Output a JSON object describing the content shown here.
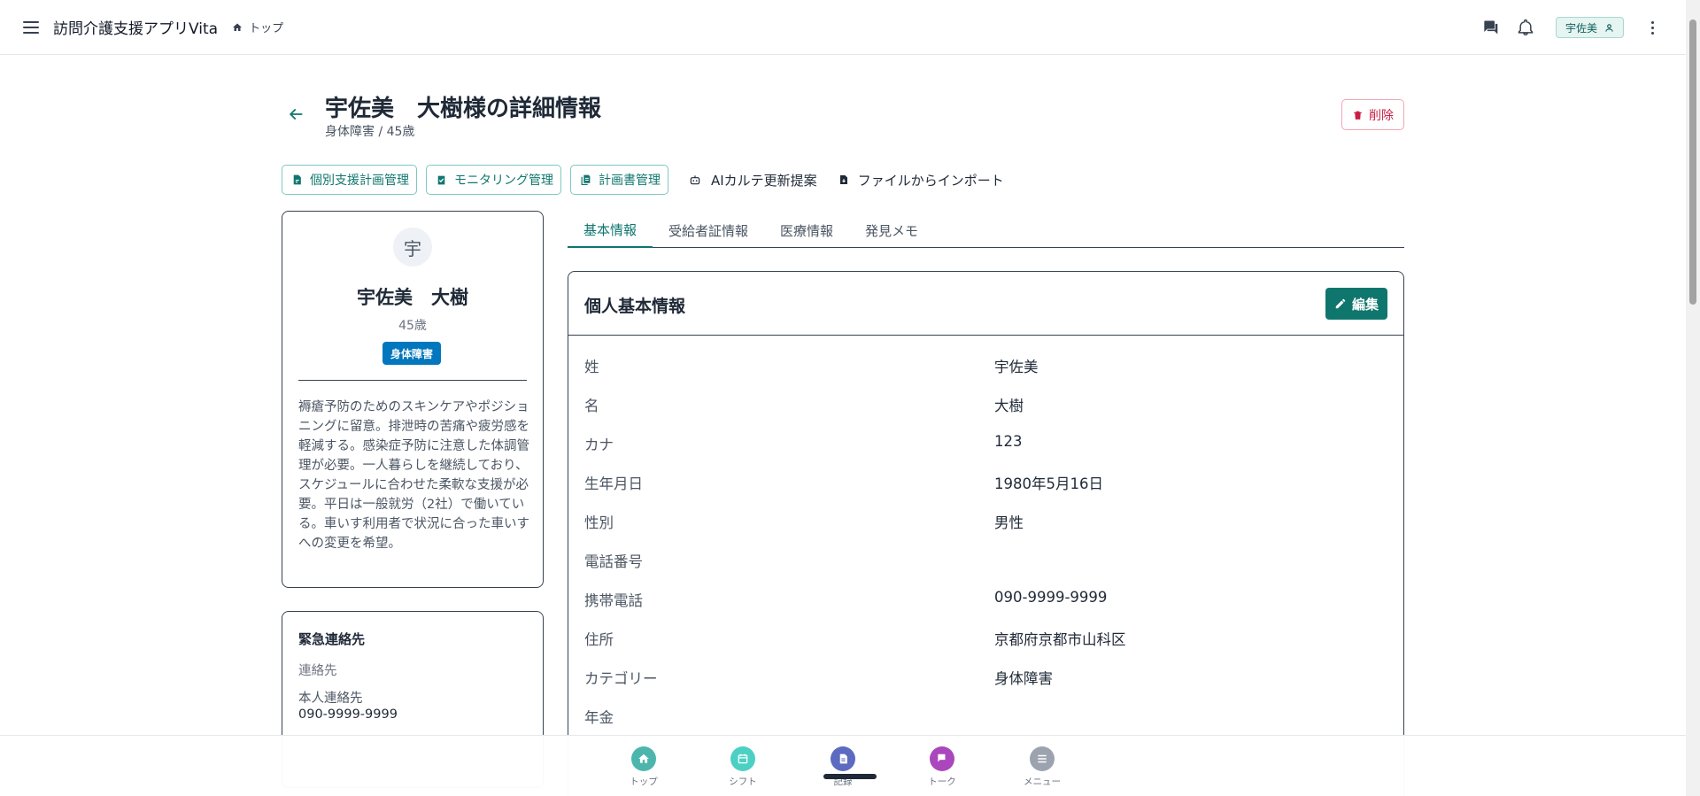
{
  "appbar": {
    "title": "訪問介護支援アプリVita",
    "breadcrumb": "トップ",
    "user_chip": "宇佐美"
  },
  "header": {
    "title": "宇佐美　大樹様の詳細情報",
    "subtitle": "身体障害 / 45歳",
    "delete_label": "削除"
  },
  "actions": [
    {
      "label": "個別支援計画管理",
      "icon": "document-edit-icon"
    },
    {
      "label": "モニタリング管理",
      "icon": "clipboard-check-icon"
    },
    {
      "label": "計画書管理",
      "icon": "documents-icon"
    },
    {
      "label": "AIカルテ更新提案",
      "icon": "robot-icon"
    },
    {
      "label": "ファイルからインポート",
      "icon": "file-import-icon"
    }
  ],
  "profile": {
    "avatar_initial": "宇",
    "name": "宇佐美　大樹",
    "age": "45歳",
    "badge": "身体障害",
    "note": "褥瘡予防のためのスキンケアやポジショニングに留意。排泄時の苦痛や疲労感を軽減する。感染症予防に注意した体調管理が必要。一人暮らしを継続しており、スケジュールに合わせた柔軟な支援が必要。平日は一般就労（2社）で働いている。車いす利用者で状況に合った車いすへの変更を希望。"
  },
  "emergency": {
    "title": "緊急連絡先",
    "label": "連絡先",
    "contact_name": "本人連絡先",
    "contact_phone": "090-9999-9999"
  },
  "tabs": [
    {
      "label": "基本情報",
      "active": true
    },
    {
      "label": "受給者証情報",
      "active": false
    },
    {
      "label": "医療情報",
      "active": false
    },
    {
      "label": "発見メモ",
      "active": false
    }
  ],
  "info": {
    "title": "個人基本情報",
    "edit_label": "編集",
    "rows": [
      {
        "label": "姓",
        "value": "宇佐美"
      },
      {
        "label": "名",
        "value": "大樹"
      },
      {
        "label": "カナ",
        "value": "123"
      },
      {
        "label": "生年月日",
        "value": "1980年5月16日"
      },
      {
        "label": "性別",
        "value": "男性"
      },
      {
        "label": "電話番号",
        "value": ""
      },
      {
        "label": "携帯電話",
        "value": "090-9999-9999"
      },
      {
        "label": "住所",
        "value": "京都府京都市山科区"
      },
      {
        "label": "カテゴリー",
        "value": "身体障害"
      },
      {
        "label": "年金",
        "value": ""
      }
    ]
  },
  "bottom_nav": [
    {
      "label": "トップ",
      "icon": "home-icon",
      "color": "#4db6ac"
    },
    {
      "label": "シフト",
      "icon": "calendar-icon",
      "color": "#4dd0c4"
    },
    {
      "label": "記録",
      "icon": "document-icon",
      "color": "#5c6bc0"
    },
    {
      "label": "トーク",
      "icon": "chat-icon",
      "color": "#ab47bc"
    },
    {
      "label": "メニュー",
      "icon": "menu-icon",
      "color": "#9ca3af"
    }
  ],
  "colors": {
    "primary": "#0f766e",
    "danger": "#c81e45",
    "badge": "#0277bd"
  }
}
